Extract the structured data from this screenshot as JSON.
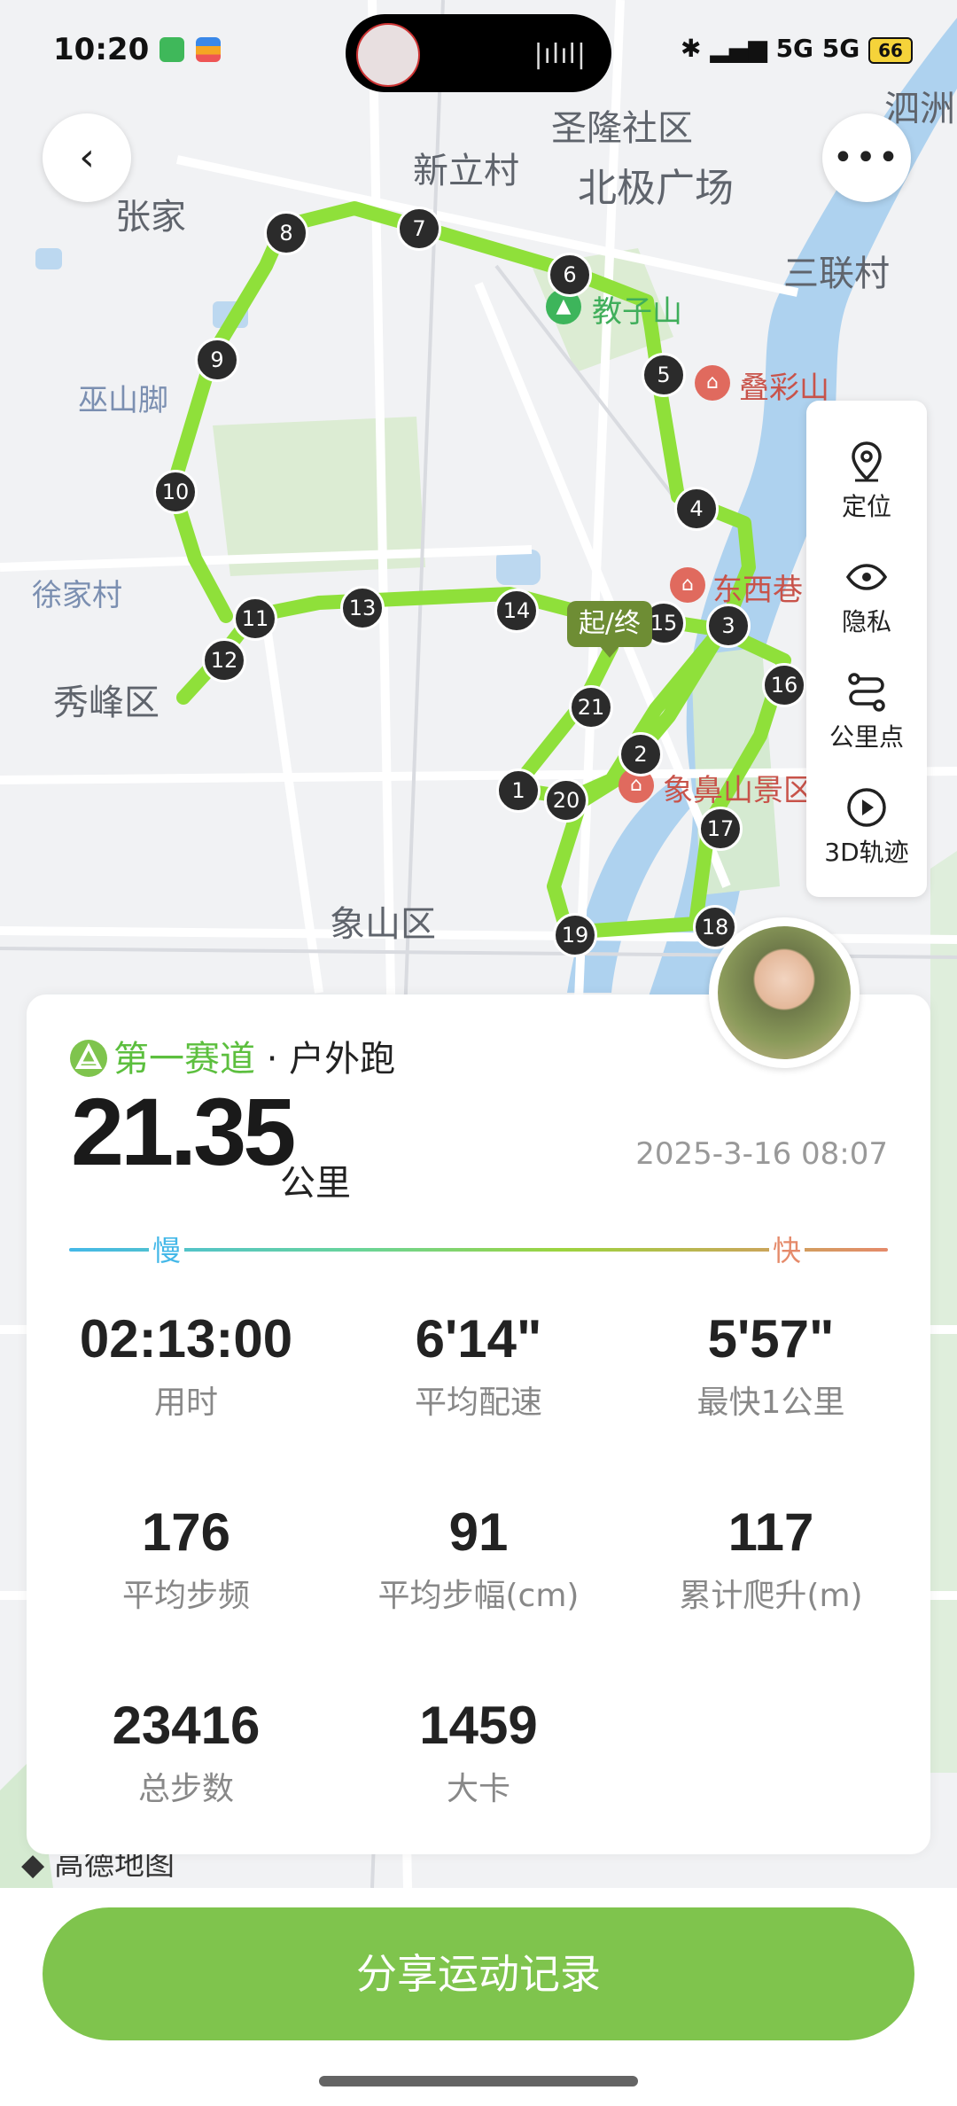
{
  "status_bar": {
    "time": "10:20",
    "network": "5G 5G",
    "battery": "66"
  },
  "map": {
    "labels": [
      {
        "name": "map-label-shenglong",
        "text": "圣隆社区",
        "cls": "big"
      },
      {
        "name": "map-label-xinli",
        "text": "新立村",
        "cls": "big"
      },
      {
        "name": "map-label-beiji",
        "text": "北极广场",
        "cls": "big"
      },
      {
        "name": "map-label-sizhou",
        "text": "泗洲",
        "cls": "big"
      },
      {
        "name": "map-label-zhangjia",
        "text": "张家",
        "cls": "big"
      },
      {
        "name": "map-label-sanlian",
        "text": "三联村",
        "cls": "big"
      },
      {
        "name": "map-label-jiaozishan",
        "text": "教子山",
        "cls": "green"
      },
      {
        "name": "map-label-diecaishan",
        "text": "叠彩山",
        "cls": "red"
      },
      {
        "name": "map-label-wushanjiao",
        "text": "巫山脚",
        "cls": "blue"
      },
      {
        "name": "map-label-xujiacun",
        "text": "徐家村",
        "cls": "blue"
      },
      {
        "name": "map-label-dongxixiang",
        "text": "东西巷",
        "cls": "red"
      },
      {
        "name": "map-label-xiufeng",
        "text": "秀峰区",
        "cls": "big"
      },
      {
        "name": "map-label-xiangbishan",
        "text": "象鼻山景区",
        "cls": "red"
      },
      {
        "name": "map-label-xiangshan",
        "text": "象山区",
        "cls": "big"
      }
    ],
    "start_end_label": "起/终",
    "km_markers": [
      "1",
      "2",
      "3",
      "4",
      "5",
      "6",
      "7",
      "8",
      "9",
      "10",
      "11",
      "12",
      "13",
      "14",
      "15",
      "16",
      "17",
      "18",
      "19",
      "20",
      "21"
    ]
  },
  "tools": [
    {
      "label": "定位",
      "icon": "location-pin-icon"
    },
    {
      "label": "隐私",
      "icon": "eye-icon"
    },
    {
      "label": "公里点",
      "icon": "route-points-icon"
    },
    {
      "label": "3D轨迹",
      "icon": "play-icon"
    }
  ],
  "card": {
    "brand": "第一赛道",
    "activity": "· 户外跑",
    "distance": "21.35",
    "unit": "公里",
    "date": "2025-3-16 08:07",
    "slow_label": "慢",
    "fast_label": "快",
    "stats": [
      {
        "value": "02:13:00",
        "label": "用时"
      },
      {
        "value": "6'14\"",
        "label": "平均配速"
      },
      {
        "value": "5'57\"",
        "label": "最快1公里"
      },
      {
        "value": "176",
        "label": "平均步频"
      },
      {
        "value": "91",
        "label": "平均步幅(cm)"
      },
      {
        "value": "117",
        "label": "累计爬升(m)"
      },
      {
        "value": "23416",
        "label": "总步数"
      },
      {
        "value": "1459",
        "label": "大卡"
      }
    ]
  },
  "share_button": "分享运动记录",
  "colors": {
    "route": "#8fe03a",
    "accent": "#7fc44d",
    "brand": "#5cbf3e"
  }
}
